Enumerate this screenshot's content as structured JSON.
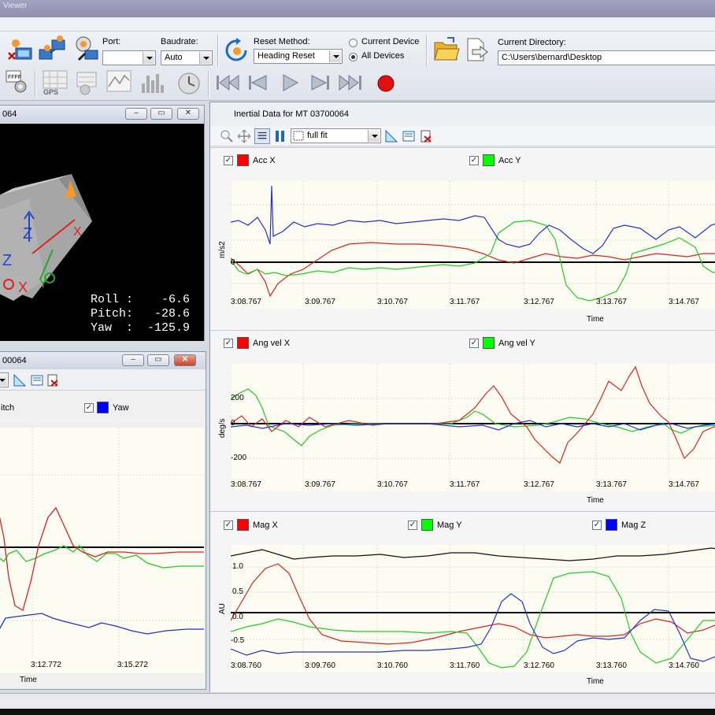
{
  "app": {
    "title": "Viewer"
  },
  "toolbar": {
    "port_label": "Port:",
    "port_value": "",
    "baudrate_label": "Baudrate:",
    "baudrate_value": "Auto",
    "reset_method_label": "Reset Method:",
    "reset_method_value": "Heading Reset",
    "radio_current": "Current Device",
    "radio_all": "All Devices",
    "radio_selected": "All Devices",
    "current_dir_label": "Current Directory:",
    "current_dir_value": "C:\\Users\\bernard\\Desktop",
    "gps_label": "GPS",
    "record_color": "#e01010"
  },
  "cube_window": {
    "title_fragment": "064",
    "readout": "Roll :    -6.6\nPitch:   -28.6\nYaw  :  -125.9"
  },
  "orientation_window": {
    "title_fragment": "00064",
    "legend": [
      {
        "label": "itch",
        "color": "#00ff00"
      },
      {
        "label": "Yaw",
        "color": "#0000ff"
      }
    ],
    "x_ticks": [
      "3:12.772",
      "3:15.272"
    ],
    "x_title": "Time"
  },
  "inertial_window": {
    "title": "Inertial Data for MT 03700064",
    "zoom_value": "full fit",
    "plots": [
      {
        "legend": [
          {
            "label": "Acc X",
            "color": "#ff0000"
          },
          {
            "label": "Acc Y",
            "color": "#00ff00"
          }
        ],
        "y_unit": "m/s2",
        "y_ticks": [
          "0"
        ],
        "x_ticks": [
          "3:08.767",
          "3:09.767",
          "3:10.767",
          "3:11.767",
          "3:12.767",
          "3:13.767",
          "3:14.767"
        ],
        "x_title": "Time"
      },
      {
        "legend": [
          {
            "label": "Ang vel X",
            "color": "#ff0000"
          },
          {
            "label": "Ang vel Y",
            "color": "#00ff00"
          }
        ],
        "y_unit": "deg/s",
        "y_ticks": [
          "200",
          "0",
          "-200"
        ],
        "x_ticks": [
          "3:08.767",
          "3:09.767",
          "3:10.767",
          "3:11.767",
          "3:12.767",
          "3:13.767",
          "3:14.767"
        ],
        "x_title": "Time"
      },
      {
        "legend": [
          {
            "label": "Mag X",
            "color": "#ff0000"
          },
          {
            "label": "Mag Y",
            "color": "#00ff00"
          },
          {
            "label": "Mag Z",
            "color": "#0000ff"
          }
        ],
        "y_unit": "AU",
        "y_ticks": [
          "1.0",
          "0.5",
          "0.0",
          "-0.5"
        ],
        "x_ticks": [
          "3:08.760",
          "3:09.760",
          "3:10.760",
          "3:11.760",
          "3:12.760",
          "3:13.760",
          "3:14.760"
        ],
        "x_title": "Time"
      }
    ]
  }
}
